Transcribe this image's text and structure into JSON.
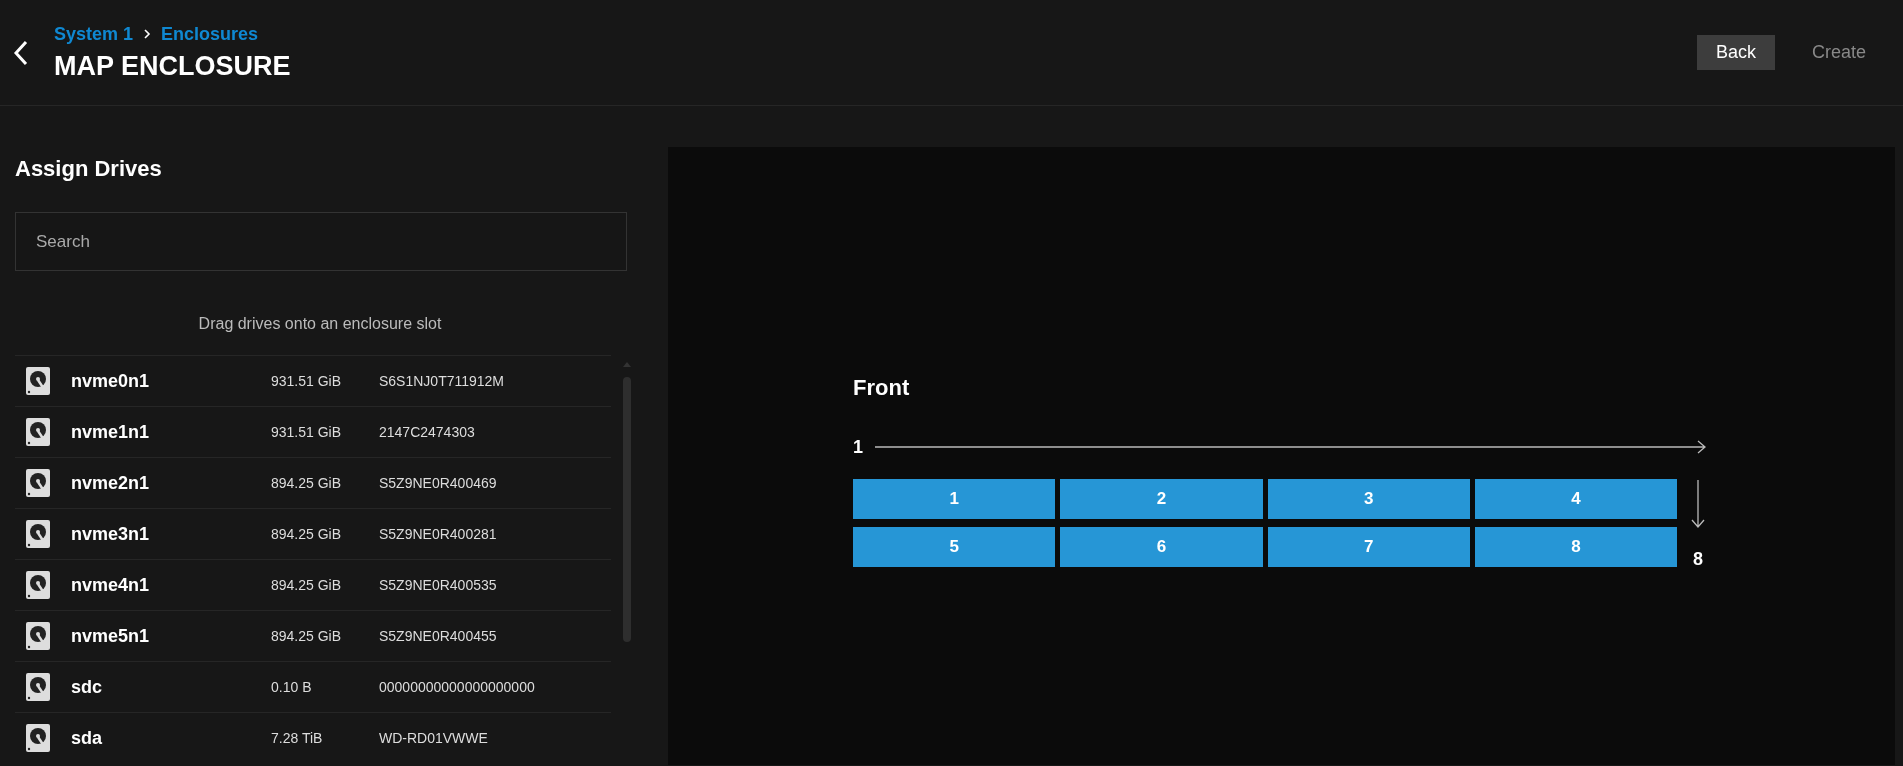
{
  "breadcrumb": [
    "System 1",
    "Enclosures"
  ],
  "title": "MAP ENCLOSURE",
  "buttons": [
    {
      "label": "Back",
      "disabled": false
    },
    {
      "label": "Create",
      "disabled": true
    }
  ],
  "assign": {
    "heading": "Assign Drives",
    "search": {
      "placeholder": "Search"
    },
    "hint": "Drag drives onto an enclosure slot",
    "drives": [
      {
        "name": "nvme0n1",
        "size": "931.51 GiB",
        "serial": "S6S1NJ0T711912M"
      },
      {
        "name": "nvme1n1",
        "size": "931.51 GiB",
        "serial": "2147C2474303"
      },
      {
        "name": "nvme2n1",
        "size": "894.25 GiB",
        "serial": "S5Z9NE0R400469"
      },
      {
        "name": "nvme3n1",
        "size": "894.25 GiB",
        "serial": "S5Z9NE0R400281"
      },
      {
        "name": "nvme4n1",
        "size": "894.25 GiB",
        "serial": "S5Z9NE0R400535"
      },
      {
        "name": "nvme5n1",
        "size": "894.25 GiB",
        "serial": "S5Z9NE0R400455"
      },
      {
        "name": "sdc",
        "size": "0.10 B",
        "serial": "00000000000000000000"
      },
      {
        "name": "sda",
        "size": "7.28 TiB",
        "serial": "WD-RD01VWWE"
      }
    ]
  },
  "enclosure": {
    "side": "Front",
    "start": "1",
    "end": "8",
    "slots": [
      "1",
      "2",
      "3",
      "4",
      "5",
      "6",
      "7",
      "8"
    ]
  }
}
